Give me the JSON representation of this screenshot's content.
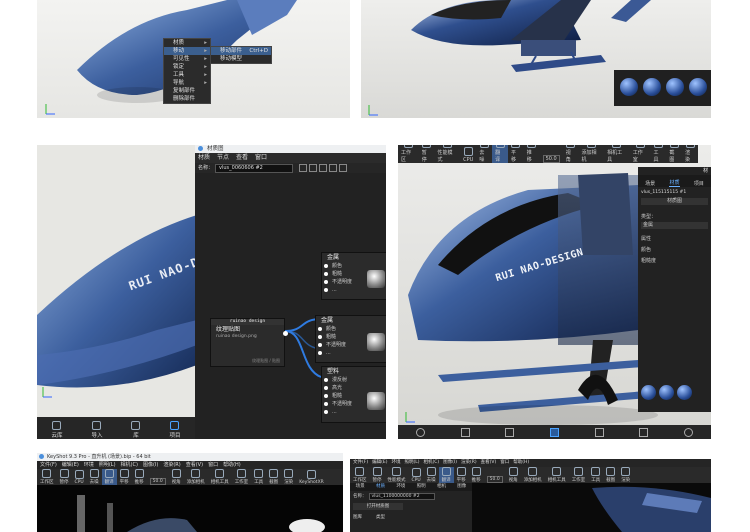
{
  "panel1": {
    "context_menu": [
      {
        "label": "材质",
        "submenu": true
      },
      {
        "label": "移动",
        "submenu": true,
        "highlighted": true
      },
      {
        "label": "可见性",
        "submenu": true
      },
      {
        "label": "锁定",
        "submenu": true
      },
      {
        "label": "工具",
        "submenu": true
      },
      {
        "label": "导航",
        "submenu": true
      },
      {
        "label": "复制部件",
        "submenu": false
      },
      {
        "label": "删除部件",
        "submenu": false
      }
    ],
    "submenu": [
      {
        "label": "移动部件",
        "shortcut": "Ctrl+D"
      },
      {
        "label": "移动模型",
        "shortcut": ""
      }
    ]
  },
  "panel3": {
    "window_title": "材质图",
    "menu": [
      "材质",
      "节点",
      "查看",
      "窗口"
    ],
    "name_label": "名称：",
    "name_value": "vlus_0060606 #2",
    "decal": "RUI NAO-D",
    "texture_node": {
      "brand": "ruinao design",
      "title": "纹理贴图",
      "file": "ruinao design.png",
      "footer": "纹理贴图 / 贴图"
    },
    "metal_node_1": {
      "title": "金属",
      "props": [
        "颜色",
        "粗糙",
        "不透明度",
        "..."
      ]
    },
    "metal_node_2": {
      "title": "金属",
      "props": [
        "颜色",
        "粗糙",
        "不透明度",
        "..."
      ]
    },
    "plastic_node": {
      "title": "塑料",
      "props": [
        "漫反射",
        "高光",
        "粗糙",
        "不透明度",
        "..."
      ]
    },
    "bottom_buttons": [
      "云库",
      "导入",
      "库",
      "项目"
    ]
  },
  "panel4": {
    "toolbar": [
      "工作区",
      "暂停",
      "性能模式",
      "CPU",
      "去噪",
      "翻译",
      "平移",
      "推移",
      "视角",
      "添加相机",
      "相机工具",
      "工作室",
      "工具",
      "截图",
      "渲染"
    ],
    "zoom": "50.0",
    "side_tabs": [
      "场景",
      "材质",
      "项目"
    ],
    "side_title": "材",
    "side_name": "vlus_115115115 #1",
    "side_fields": [
      "材质图",
      "类型：",
      "金属",
      "属性",
      "颜色",
      "粗糙度"
    ],
    "decal": "RUI NAO-DESIGN"
  },
  "panel5": {
    "title": "KeyShot 9.3 Pro - 直升机 (场景).bip - 64 bit",
    "menu": [
      "文件(F)",
      "编辑(E)",
      "环境",
      "照明(L)",
      "相机(C)",
      "图像(I)",
      "渲染(R)",
      "查看(V)",
      "窗口",
      "帮助(H)"
    ],
    "toolbar": [
      "工作区",
      "暂停",
      "CPU",
      "去噪",
      "翻译",
      "平移",
      "推移",
      "视角",
      "添加相机",
      "相机工具",
      "工作室",
      "工具",
      "截图",
      "渲染",
      "KeyShotXR"
    ],
    "zoom": "50.0"
  },
  "panel6": {
    "menu": [
      "文件(F)",
      "编辑(E)",
      "环境",
      "照明(L)",
      "相机(C)",
      "图像(I)",
      "渲染(R)",
      "查看(V)",
      "窗口",
      "帮助(H)"
    ],
    "toolbar": [
      "工作区",
      "暂停",
      "性能模式",
      "CPU",
      "去噪",
      "翻译",
      "平移",
      "推移",
      "视角",
      "添加相机",
      "相机工具",
      "工作室",
      "工具",
      "截图",
      "渲染"
    ],
    "zoom": "50.0",
    "tabs": [
      "场景",
      "材质",
      "环境",
      "照明",
      "相机",
      "图像"
    ],
    "name_label": "名称：",
    "name_value": "vlus_1100000000 #2",
    "graph_button": "打开材质图",
    "fields": [
      "图库",
      "类型"
    ]
  },
  "colors": {
    "blue_body": "#3c5f9e",
    "ui_dark": "#202020",
    "highlight": "#3b5f8e"
  }
}
